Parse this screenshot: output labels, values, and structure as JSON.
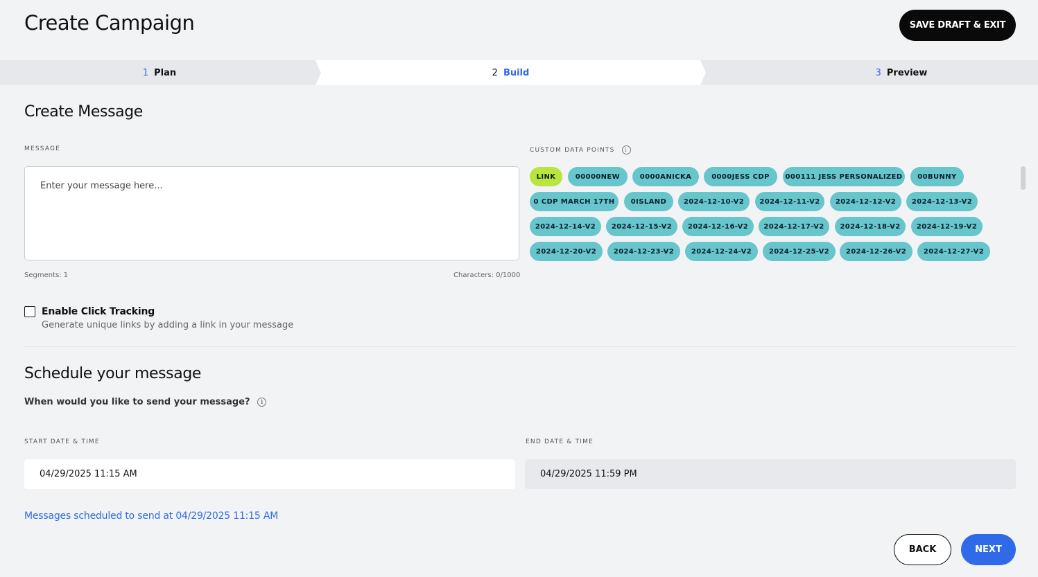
{
  "header": {
    "title": "Create Campaign",
    "save_label": "SAVE DRAFT & EXIT"
  },
  "stepper": {
    "steps": [
      {
        "num": "1",
        "label": "Plan"
      },
      {
        "num": "2",
        "label": "Build"
      },
      {
        "num": "3",
        "label": "Preview"
      }
    ],
    "active": "Build"
  },
  "message": {
    "section_title": "Create Message",
    "label": "MESSAGE",
    "placeholder": "Enter your message here...",
    "value": "",
    "segments": "Segments: 1",
    "characters": "Characters: 0/1000"
  },
  "custom_data_points": {
    "label": "CUSTOM DATA POINTS",
    "info_icon": "info-icon",
    "rows": [
      [
        "LINK",
        "00000NEW",
        "0000ANICKA",
        "0000JESS CDP",
        "000111 JESS PERSONALIZED",
        "00BUNNY"
      ],
      [
        "0 CDP MARCH 17TH",
        "0ISLAND",
        "2024-12-10-V2",
        "2024-12-11-V2",
        "2024-12-12-V2",
        "2024-12-13-V2"
      ],
      [
        "2024-12-14-V2",
        "2024-12-15-V2",
        "2024-12-16-V2",
        "2024-12-17-V2",
        "2024-12-18-V2",
        "2024-12-19-V2"
      ],
      [
        "2024-12-20-V2",
        "2024-12-23-V2",
        "2024-12-24-V2",
        "2024-12-25-V2",
        "2024-12-26-V2",
        "2024-12-27-V2"
      ]
    ],
    "colors": {
      "link": "#b9e53d",
      "default": "#67c5cc"
    }
  },
  "click_tracking": {
    "title": "Enable Click Tracking",
    "subtitle": "Generate unique links by adding a link in your message",
    "checked": false
  },
  "schedule": {
    "section_title": "Schedule your message",
    "question": "When would you like to send your message?",
    "start_label": "START DATE & TIME",
    "start_value": "04/29/2025 11:15 AM",
    "end_label": "END DATE & TIME",
    "end_value": "04/29/2025 11:59 PM",
    "note": "Messages scheduled to send at 04/29/2025 11:15 AM"
  },
  "footer": {
    "back_label": "BACK",
    "next_label": "NEXT"
  },
  "colors": {
    "accent": "#2f6be8",
    "background": "#f2f3f5",
    "dark_button": "#0a0a0a"
  }
}
